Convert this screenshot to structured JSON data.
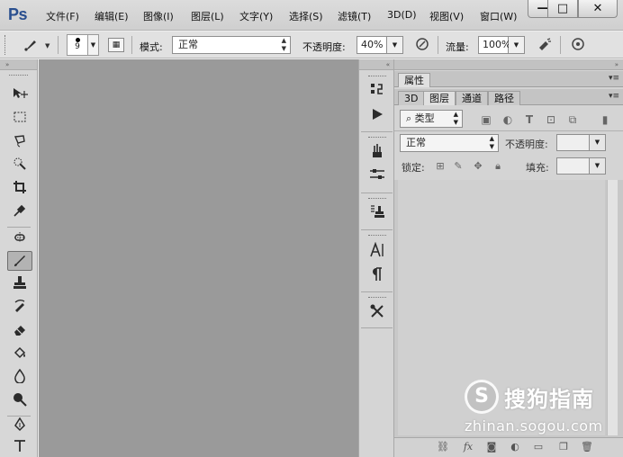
{
  "app": {
    "logo": "Ps"
  },
  "menu": [
    "文件(F)",
    "编辑(E)",
    "图像(I)",
    "图层(L)",
    "文字(Y)",
    "选择(S)",
    "滤镜(T)",
    "3D(D)",
    "视图(V)",
    "窗口(W)"
  ],
  "window_controls": {
    "minimize": "—",
    "maximize": "□",
    "close": "✕"
  },
  "options": {
    "brush_size": "9",
    "mode_label": "模式:",
    "mode_value": "正常",
    "opacity_label": "不透明度:",
    "opacity_value": "40%",
    "flow_label": "流量:",
    "flow_value": "100%"
  },
  "panels": {
    "properties_tab": "属性",
    "tabs": [
      "3D",
      "图层",
      "通道",
      "路径"
    ],
    "active_tab": "图层",
    "filter_kind": "类型",
    "blend_mode": "正常",
    "opacity_label": "不透明度:",
    "lock_label": "锁定:",
    "fill_label": "填充:"
  },
  "watermark": {
    "logo": "S",
    "name": "搜狗指南",
    "url": "zhinan.sogou.com"
  },
  "colors": {
    "accent": "#2a4f8f",
    "canvas": "#9a9a9a",
    "panel": "#d4d4d4"
  }
}
